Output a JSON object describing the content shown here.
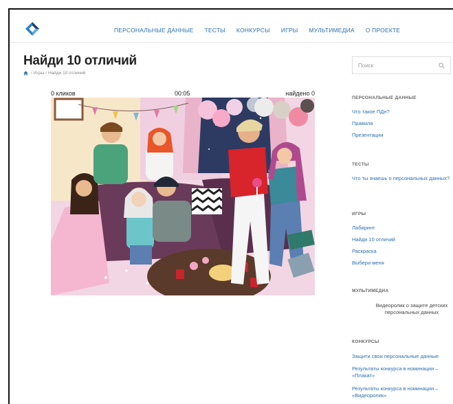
{
  "header": {
    "nav": [
      {
        "label": "ПЕРСОНАЛЬНЫЕ ДАННЫЕ"
      },
      {
        "label": "ТЕСТЫ"
      },
      {
        "label": "КОНКУРСЫ"
      },
      {
        "label": "ИГРЫ"
      },
      {
        "label": "МУЛЬТИМЕДИА"
      },
      {
        "label": "О ПРОЕКТЕ"
      }
    ]
  },
  "page": {
    "title": "Найди 10 отличий",
    "breadcrumb": {
      "sep": "/",
      "items": [
        {
          "label": "Игры"
        },
        {
          "label": "Найди 10 отличий"
        }
      ]
    }
  },
  "game": {
    "clicks": "0 кликов",
    "timer": "00:05",
    "found": "найдено 0"
  },
  "sidebar": {
    "search_placeholder": "Поиск",
    "personal": {
      "title": "ПЕРСОНАЛЬНЫЕ ДАННЫЕ",
      "links": [
        {
          "label": "Что такое ПДн?"
        },
        {
          "label": "Правила"
        },
        {
          "label": "Презентации"
        }
      ]
    },
    "tests": {
      "title": "ТЕСТЫ",
      "links": [
        {
          "label": "Что ты знаешь о персональных данных?"
        }
      ]
    },
    "games": {
      "title": "ИГРЫ",
      "links": [
        {
          "label": "Лабиринт"
        },
        {
          "label": "Найди 10 отличий"
        },
        {
          "label": "Раскраска"
        },
        {
          "label": "Выбери меня"
        }
      ]
    },
    "multimedia": {
      "title": "МУЛЬТИМЕДИА",
      "video": {
        "label": "Видеоролик о защите детских персональных данных"
      }
    },
    "contests": {
      "title": "КОНКУРСЫ",
      "links": [
        {
          "label": "Защити свои персональные данные"
        },
        {
          "label": "Результаты конкурса в номинации – «Плакат»"
        },
        {
          "label": "Результаты конкурса в номинации – «Видеоролик»"
        }
      ]
    }
  },
  "colors": {
    "link": "#2a6fb1",
    "logo_blue": "#2a7fc1",
    "logo_dark": "#1d3f6e"
  }
}
